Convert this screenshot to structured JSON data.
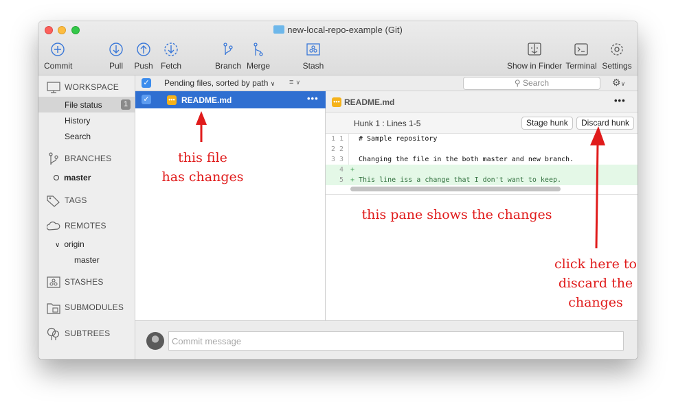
{
  "window": {
    "title": "new-local-repo-example (Git)"
  },
  "toolbar": {
    "commit": "Commit",
    "pull": "Pull",
    "push": "Push",
    "fetch": "Fetch",
    "branch": "Branch",
    "merge": "Merge",
    "stash": "Stash",
    "show_in_finder": "Show in Finder",
    "terminal": "Terminal",
    "settings": "Settings"
  },
  "sidebar": {
    "workspace": "WORKSPACE",
    "file_status": "File status",
    "file_status_count": "1",
    "history": "History",
    "search": "Search",
    "branches": "BRANCHES",
    "current_branch": "master",
    "tags": "TAGS",
    "remotes": "REMOTES",
    "remote_origin": "origin",
    "remote_branch": "master",
    "stashes": "STASHES",
    "submodules": "SUBMODULES",
    "subtrees": "SUBTREES"
  },
  "filebar": {
    "sort_label": "Pending files, sorted by path",
    "search_placeholder": "Search"
  },
  "files": [
    {
      "name": "README.md"
    }
  ],
  "diff": {
    "file": "README.md",
    "hunk_title": "Hunk 1 : Lines 1-5",
    "stage_hunk": "Stage hunk",
    "discard_hunk": "Discard hunk",
    "lines": [
      {
        "old": "1",
        "new": "1",
        "text": "# Sample repository",
        "added": false
      },
      {
        "old": "2",
        "new": "2",
        "text": "",
        "added": false
      },
      {
        "old": "3",
        "new": "3",
        "text": "Changing the file in the both master and new branch.",
        "added": false
      },
      {
        "old": "",
        "new": "4",
        "text": "",
        "added": true
      },
      {
        "old": "",
        "new": "5",
        "text": "This line iss a change that I don't want to keep.",
        "added": true
      }
    ]
  },
  "commit": {
    "placeholder": "Commit message"
  },
  "annotations": {
    "file_note_1": "this file",
    "file_note_2": "has changes",
    "pane_note": "this pane shows the changes",
    "discard_note_1": "click here to",
    "discard_note_2": "discard the",
    "discard_note_3": "changes"
  },
  "colors": {
    "selection": "#2f6fd1",
    "added_line_bg": "#e4f8e7",
    "annotation": "#e01b1b"
  }
}
